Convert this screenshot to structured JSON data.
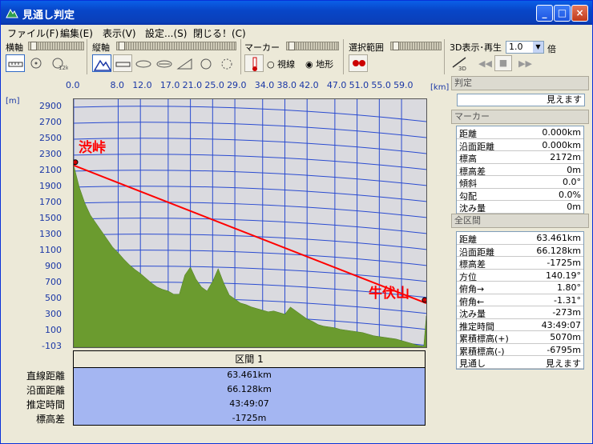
{
  "window": {
    "title": "見通し判定"
  },
  "menu": [
    "ファイル(F)",
    "編集(E)",
    "表示(V)",
    "設定...(S)",
    "閉じる！(C)"
  ],
  "toolbar": {
    "horizontal_label": "横軸",
    "vertical_label": "縦軸",
    "marker_label": "マーカー",
    "range_label": "選択範囲",
    "playback_label": "3D表示･再生",
    "speed_value": "1.0",
    "speed_unit": "倍",
    "view_option": "視線",
    "terrain_option": "地形",
    "selected_option": "地形"
  },
  "plot": {
    "x_unit": "[m]",
    "km_unit": "[km]",
    "point_a": "渋峠",
    "point_b": "牛伏山"
  },
  "chart_data": {
    "type": "area",
    "xlabel": "[km]",
    "ylabel": "[m]",
    "x_ticks": [
      "0.0",
      "8.0",
      "12.0",
      "17.0",
      "21.0",
      "25.0",
      "29.0",
      "34.0",
      "38.0",
      "42.0",
      "47.0",
      "51.0",
      "55.0",
      "59.0"
    ],
    "y_ticks": [
      "2900",
      "2700",
      "2500",
      "2300",
      "2100",
      "1900",
      "1700",
      "1500",
      "1300",
      "1100",
      "900",
      "700",
      "500",
      "300",
      "100",
      "-103"
    ],
    "xlim": [
      0,
      63.461
    ],
    "ylim": [
      -103,
      3000
    ],
    "terrain_x": [
      0,
      1,
      2,
      3,
      4,
      5,
      6,
      7,
      8,
      9,
      10,
      11,
      12,
      13,
      14,
      15,
      16,
      17,
      18,
      19,
      20,
      21,
      22,
      23,
      24,
      25,
      26,
      27,
      28,
      29,
      30,
      31,
      32,
      33,
      34,
      35,
      36,
      37,
      38,
      39,
      40,
      41,
      42,
      43,
      44,
      45,
      46,
      47,
      48,
      49,
      50,
      51,
      52,
      53,
      54,
      55,
      56,
      57,
      58,
      59,
      60,
      61,
      62,
      63,
      63.461
    ],
    "terrain_y": [
      2172,
      1900,
      1700,
      1550,
      1450,
      1350,
      1250,
      1150,
      1080,
      1000,
      930,
      870,
      820,
      760,
      700,
      650,
      620,
      600,
      560,
      560,
      800,
      900,
      750,
      650,
      600,
      720,
      880,
      700,
      550,
      500,
      450,
      430,
      400,
      380,
      360,
      340,
      350,
      330,
      310,
      400,
      350,
      300,
      250,
      220,
      180,
      160,
      150,
      140,
      120,
      110,
      100,
      90,
      80,
      60,
      40,
      30,
      20,
      10,
      0,
      -20,
      -40,
      -60,
      -80,
      -90,
      290
    ],
    "sight_line": [
      [
        0,
        2172
      ],
      [
        63.461,
        447
      ]
    ]
  },
  "section": {
    "header": "区間 1",
    "labels": [
      "直線距離",
      "沿面距離",
      "推定時間",
      "標高差"
    ],
    "values": [
      "63.461km",
      "66.128km",
      "43:49:07",
      "-1725m"
    ]
  },
  "side": {
    "judge_header": "判定",
    "judge_value": "見えます",
    "marker_header": "マーカー",
    "marker_rows": [
      {
        "k": "距離",
        "v": "0.000km"
      },
      {
        "k": "沿面距離",
        "v": "0.000km"
      },
      {
        "k": "標高",
        "v": "2172m"
      },
      {
        "k": "標高差",
        "v": "0m"
      },
      {
        "k": "傾斜",
        "v": "0.0°"
      },
      {
        "k": "勾配",
        "v": "0.0%"
      },
      {
        "k": "沈み量",
        "v": "0m"
      }
    ],
    "total_header": "全区間",
    "total_rows": [
      {
        "k": "距離",
        "v": "63.461km"
      },
      {
        "k": "沿面距離",
        "v": "66.128km"
      },
      {
        "k": "標高差",
        "v": "-1725m"
      },
      {
        "k": "方位",
        "v": "140.19°"
      },
      {
        "k": "俯角→",
        "v": "1.80°"
      },
      {
        "k": "俯角←",
        "v": "-1.31°"
      },
      {
        "k": "沈み量",
        "v": "-273m"
      },
      {
        "k": "推定時間",
        "v": "43:49:07"
      },
      {
        "k": "累積標高(+)",
        "v": "5070m"
      },
      {
        "k": "累積標高(-)",
        "v": "-6795m"
      },
      {
        "k": "見通し",
        "v": "見えます"
      }
    ]
  }
}
